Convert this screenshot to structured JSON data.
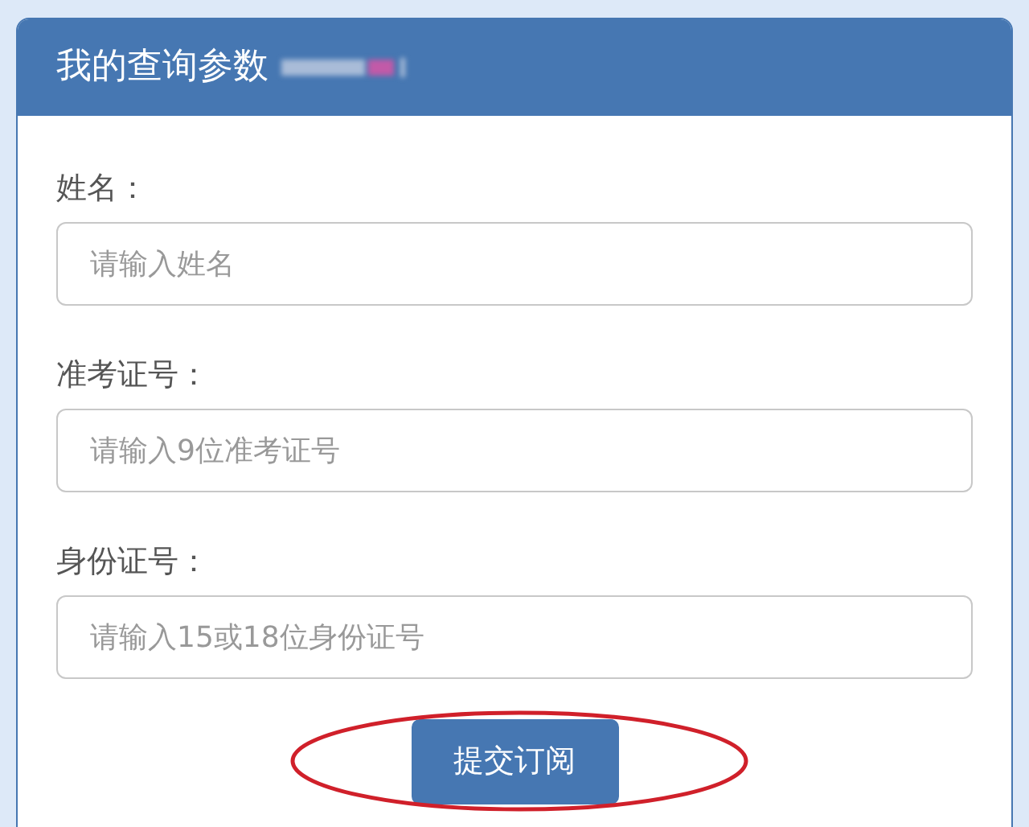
{
  "panel": {
    "title": "我的查询参数"
  },
  "fields": [
    {
      "label": "姓名：",
      "placeholder": "请输入姓名"
    },
    {
      "label": "准考证号：",
      "placeholder": "请输入9位准考证号"
    },
    {
      "label": "身份证号：",
      "placeholder": "请输入15或18位身份证号"
    }
  ],
  "submit_button": {
    "label": "提交订阅"
  },
  "annotation": {
    "kind": "ellipse",
    "color": "#d0202a"
  }
}
